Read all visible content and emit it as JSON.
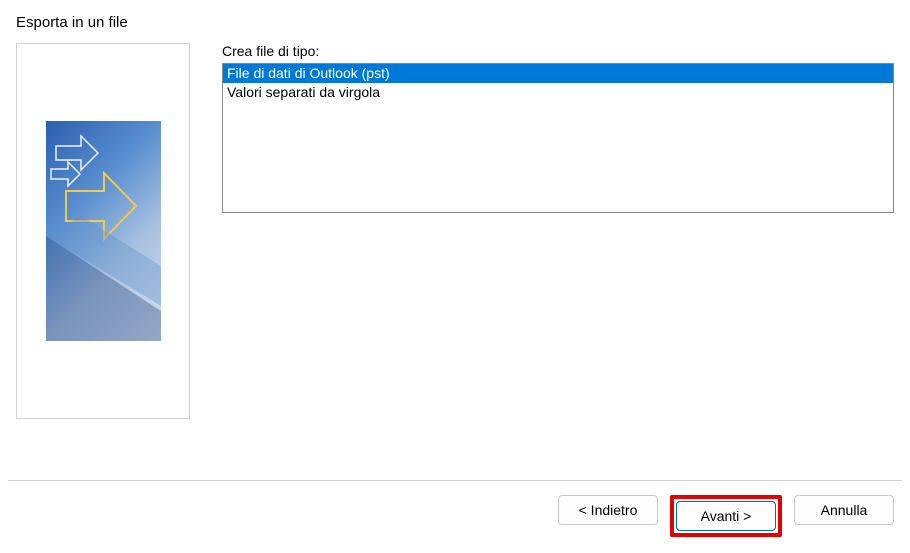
{
  "dialog": {
    "title": "Esporta in un file"
  },
  "content": {
    "list_label": "Crea file di tipo:",
    "list_items": [
      {
        "label": "File di dati di Outlook (pst)",
        "selected": true
      },
      {
        "label": "Valori separati da virgola",
        "selected": false
      }
    ]
  },
  "buttons": {
    "back": "< Indietro",
    "next": "Avanti >",
    "cancel": "Annulla"
  },
  "annotation": {
    "next_highlighted": true
  }
}
